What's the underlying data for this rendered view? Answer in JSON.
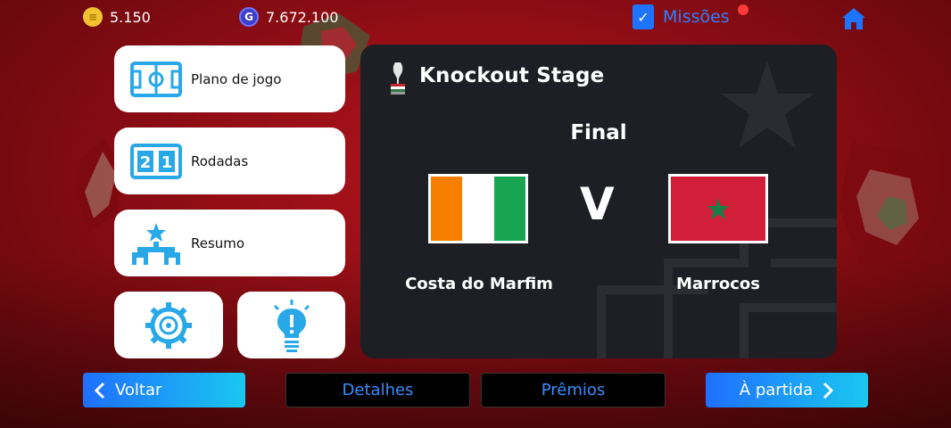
{
  "currencies": {
    "coins": "5.150",
    "gp": "7.672.100"
  },
  "header": {
    "missions_label": "Missões",
    "home_icon": "home-icon"
  },
  "menu": {
    "game_plan_label": "Plano de jogo",
    "rounds_label": "Rodadas",
    "summary_label": "Resumo",
    "settings_icon": "gear-icon",
    "tips_icon": "lightbulb-icon"
  },
  "match": {
    "stage_title": "Knockout Stage",
    "round": "Final",
    "vs": "V",
    "home_team": "Costa do Marfim",
    "away_team": "Marrocos",
    "home_flag_colors": [
      "#f77f00",
      "#ffffff",
      "#17a551"
    ],
    "away_flag_color": "#d11f3a",
    "away_star_color": "#1a7d45"
  },
  "footer": {
    "back_label": "Voltar",
    "details_label": "Detalhes",
    "prizes_label": "Prêmios",
    "to_match_label": "À partida"
  }
}
